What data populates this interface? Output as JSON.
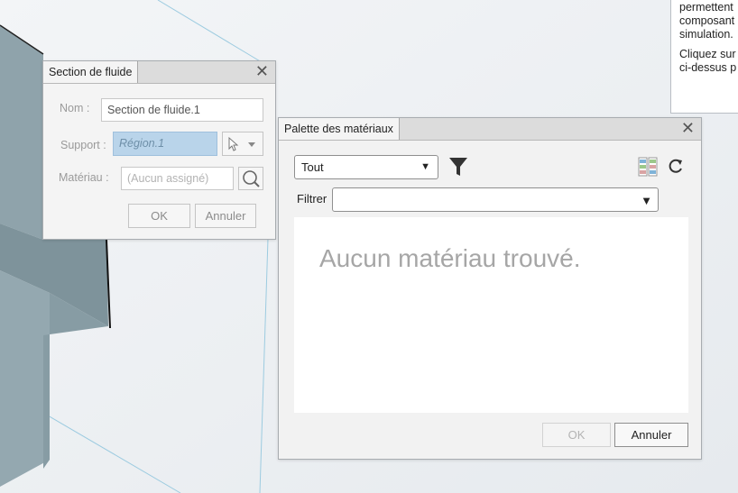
{
  "help": {
    "line1": "permettent",
    "line2": "composant",
    "line3": "simulation.",
    "line4": "Cliquez sur",
    "line5": "ci-dessus p"
  },
  "fluid_dialog": {
    "title": "Section de fluide",
    "name_label": "Nom :",
    "name_value": "Section de fluide.1",
    "support_label": "Support :",
    "support_value": "Région.1",
    "material_label": "Matériau :",
    "material_placeholder": "(Aucun assigné)",
    "ok": "OK",
    "cancel": "Annuler"
  },
  "palette_dialog": {
    "title": "Palette des matériaux",
    "category_value": "Tout",
    "filter_label": "Filtrer",
    "filter_value": "",
    "empty_message": "Aucun matériau trouvé.",
    "ok": "OK",
    "cancel": "Annuler"
  },
  "colors": {
    "accent_selection": "#b9d4ea",
    "part_face": "#8a9ea6"
  }
}
